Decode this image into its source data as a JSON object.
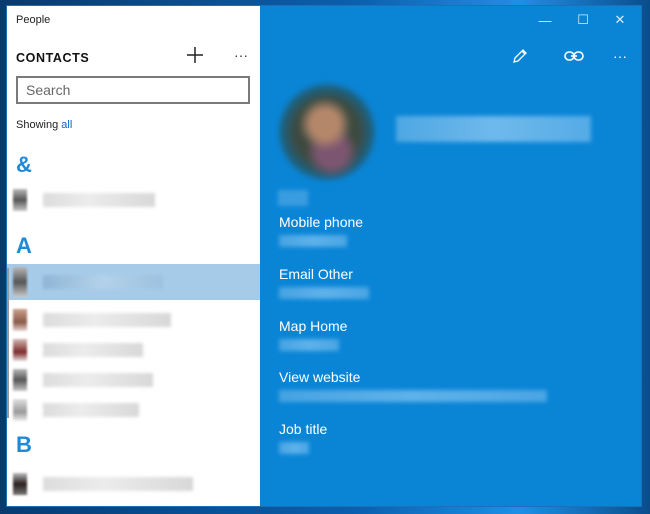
{
  "app": {
    "title": "People"
  },
  "contacts": {
    "header": "CONTACTS",
    "add_icon": "plus-icon",
    "more_icon": "more-icon",
    "search_placeholder": "Search",
    "showing_prefix": "Showing",
    "showing_filter": "all",
    "groups": [
      {
        "letter": "&"
      },
      {
        "letter": "A"
      },
      {
        "letter": "B"
      }
    ]
  },
  "window_controls": {
    "minimize": "—",
    "maximize": "☐",
    "close": "✕"
  },
  "detail": {
    "actions": [
      "edit-icon",
      "link-icon",
      "more-icon"
    ],
    "fields": [
      {
        "label": "Mobile phone"
      },
      {
        "label": "Email Other"
      },
      {
        "label": "Map Home"
      },
      {
        "label": "View website"
      },
      {
        "label": "Job title"
      }
    ]
  },
  "colors": {
    "accent": "#0a85d6",
    "selected_row": "#a6cbe9",
    "group_letter": "#1f8ad8"
  }
}
